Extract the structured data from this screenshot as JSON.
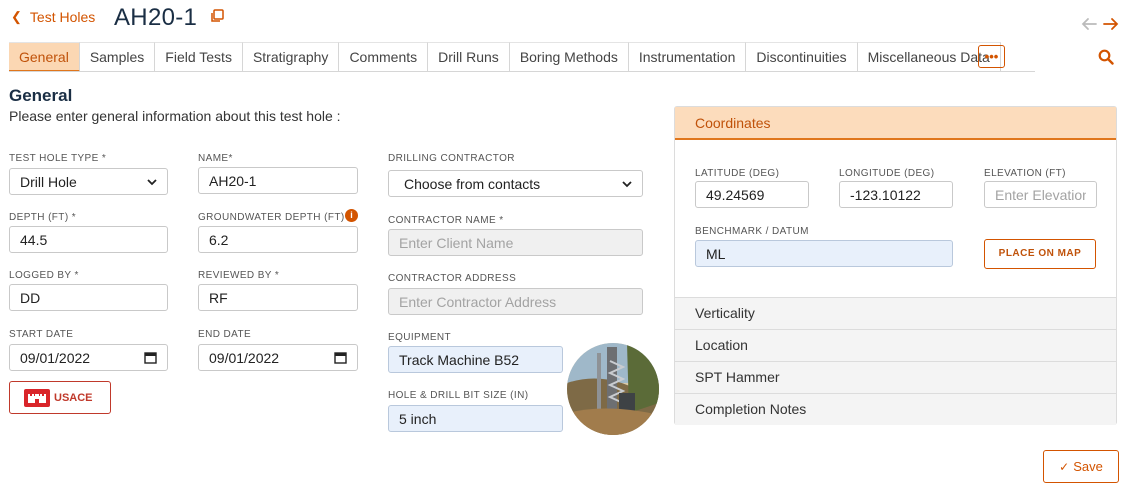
{
  "header": {
    "back_label": "Test Holes",
    "title": "AH20-1"
  },
  "tabs": [
    {
      "label": "General",
      "active": true
    },
    {
      "label": "Samples"
    },
    {
      "label": "Field Tests"
    },
    {
      "label": "Stratigraphy"
    },
    {
      "label": "Comments"
    },
    {
      "label": "Drill Runs"
    },
    {
      "label": "Boring Methods"
    },
    {
      "label": "Instrumentation"
    },
    {
      "label": "Discontinuities"
    },
    {
      "label": "Miscellaneous Data"
    }
  ],
  "tabs_more": "•••",
  "section": {
    "title": "General",
    "subtitle": "Please enter general information about this test hole :"
  },
  "form": {
    "test_hole_type": {
      "label": "TEST HOLE TYPE *",
      "value": "Drill Hole"
    },
    "name": {
      "label": "NAME*",
      "value": "AH20-1"
    },
    "depth": {
      "label": "DEPTH (FT) *",
      "value": "44.5"
    },
    "groundwater_depth": {
      "label": "GROUNDWATER DEPTH (FT)",
      "value": "6.2",
      "info": "i"
    },
    "logged_by": {
      "label": "LOGGED BY *",
      "value": "DD"
    },
    "reviewed_by": {
      "label": "REVIEWED BY *",
      "value": "RF"
    },
    "start_date": {
      "label": "START DATE",
      "value": "09/01/2022"
    },
    "end_date": {
      "label": "END DATE",
      "value": "09/01/2022"
    },
    "usace_label": "USACE",
    "drilling_contractor": {
      "label": "DRILLING CONTRACTOR",
      "value": "Choose from contacts"
    },
    "contractor_name": {
      "label": "CONTRACTOR NAME *",
      "placeholder": "Enter Client Name"
    },
    "contractor_address": {
      "label": "CONTRACTOR ADDRESS",
      "placeholder": "Enter Contractor Address"
    },
    "equipment": {
      "label": "EQUIPMENT",
      "value": "Track Machine B52"
    },
    "hole_bit_size": {
      "label": "HOLE & DRILL BIT SIZE (IN)",
      "value": "5 inch"
    }
  },
  "coordinates": {
    "header": "Coordinates",
    "latitude": {
      "label": "LATITUDE (DEG)",
      "value": "49.24569"
    },
    "longitude": {
      "label": "LONGITUDE (DEG)",
      "value": "-123.10122"
    },
    "elevation": {
      "label": "ELEVATION (FT)",
      "placeholder": "Enter Elevation"
    },
    "benchmark": {
      "label": "BENCHMARK / DATUM",
      "value": "ML"
    },
    "place_on_map": "PLACE ON MAP"
  },
  "accordion": [
    "Verticality",
    "Location",
    "SPT Hammer",
    "Completion Notes"
  ],
  "save_label": "Save",
  "colors": {
    "accent": "#d35400",
    "tab_active_bg": "#fbd7b3",
    "title": "#1a2e44",
    "usace_red": "#d9252a"
  },
  "icons": {
    "back": "chevron-left-icon",
    "copy": "copy-icon",
    "prev": "arrow-left-icon",
    "next": "arrow-right-icon",
    "search": "search-icon",
    "calendar": "calendar-icon",
    "info": "info-icon",
    "save": "check-icon"
  }
}
